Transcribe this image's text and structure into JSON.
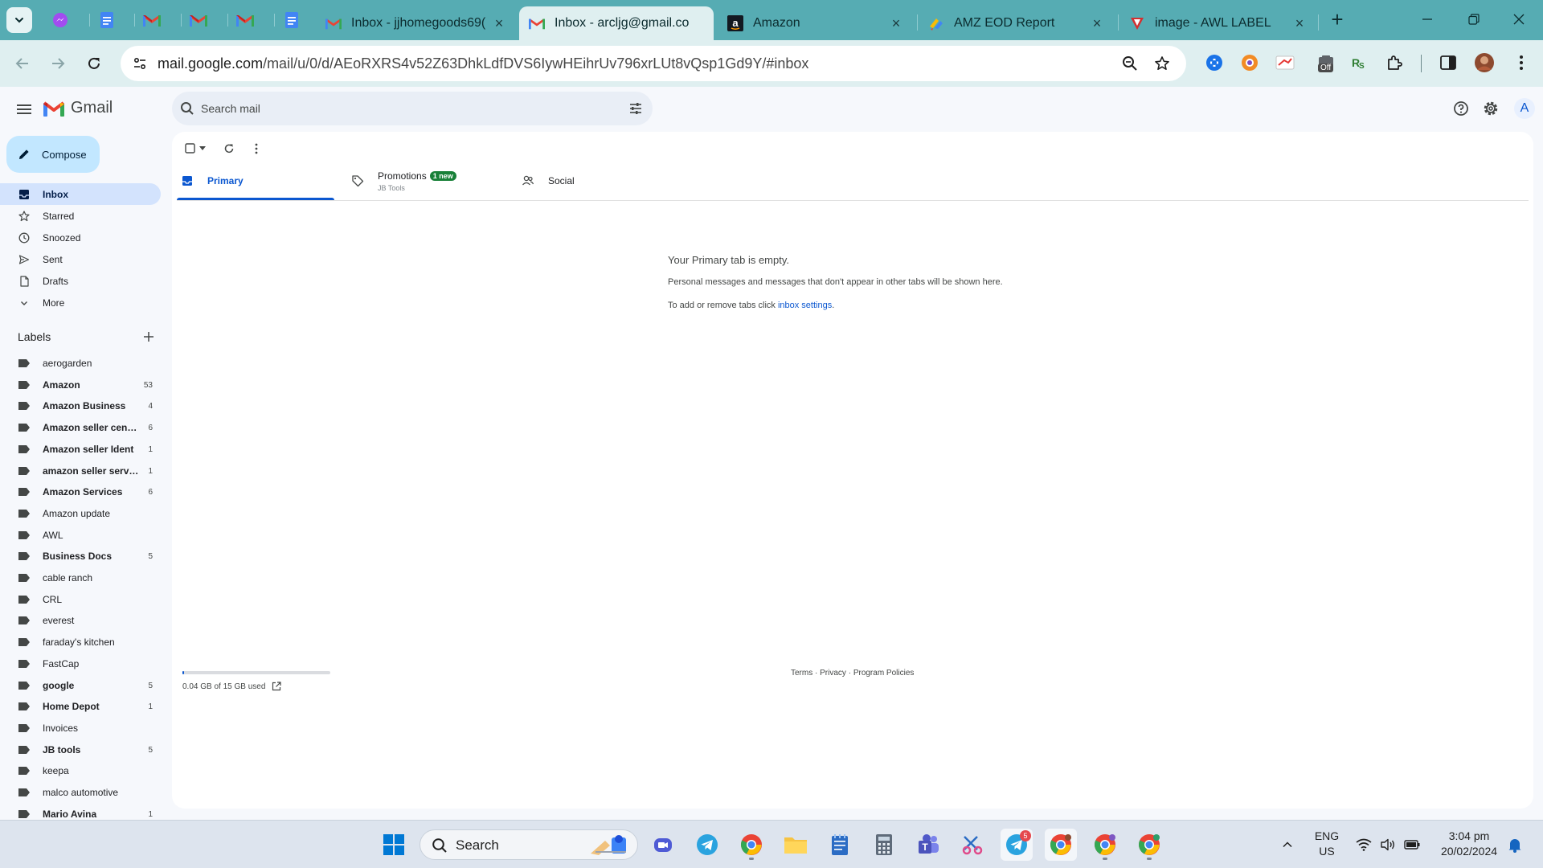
{
  "browser": {
    "pinned_tabs": [
      "messenger",
      "docs",
      "gmail",
      "gmail",
      "gmail",
      "docs"
    ],
    "tabs": [
      {
        "title": "Inbox - jjhomegoods69(",
        "favicon": "gmail-icon",
        "active": false
      },
      {
        "title": "Inbox - arcljg@gmail.co",
        "favicon": "gmail-icon",
        "active": true
      },
      {
        "title": "Amazon",
        "favicon": "amazon-icon",
        "active": false
      },
      {
        "title": "AMZ EOD Report",
        "favicon": "apps-script-icon",
        "active": false
      },
      {
        "title": "image - AWL LABEL",
        "favicon": "awl-icon",
        "active": false
      }
    ],
    "url_host": "mail.google.com",
    "url_path": "/mail/u/0/d/AEoRXRS4v52Z63DhkLdfDVS6IywHEihrUv796xrLUt8vQsp1Gd9Y/#inbox",
    "extension_badge": "Off"
  },
  "gmail": {
    "app_name": "Gmail",
    "search_placeholder": "Search mail",
    "account_initial": "A",
    "compose_label": "Compose",
    "nav": [
      {
        "label": "Inbox",
        "icon": "inbox-icon",
        "active": true
      },
      {
        "label": "Starred",
        "icon": "star-icon",
        "active": false
      },
      {
        "label": "Snoozed",
        "icon": "clock-icon",
        "active": false
      },
      {
        "label": "Sent",
        "icon": "send-icon",
        "active": false
      },
      {
        "label": "Drafts",
        "icon": "draft-icon",
        "active": false
      },
      {
        "label": "More",
        "icon": "chevron-down-icon",
        "active": false
      }
    ],
    "labels_title": "Labels",
    "labels": [
      {
        "name": "aerogarden",
        "count": "",
        "bold": false
      },
      {
        "name": "Amazon",
        "count": "53",
        "bold": true
      },
      {
        "name": "Amazon Business",
        "count": "4",
        "bold": true
      },
      {
        "name": "Amazon seller central",
        "count": "6",
        "bold": true
      },
      {
        "name": "Amazon seller Ident",
        "count": "1",
        "bold": true
      },
      {
        "name": "amazon seller services",
        "count": "1",
        "bold": true
      },
      {
        "name": "Amazon Services",
        "count": "6",
        "bold": true
      },
      {
        "name": "Amazon update",
        "count": "",
        "bold": false
      },
      {
        "name": "AWL",
        "count": "",
        "bold": false
      },
      {
        "name": "Business Docs",
        "count": "5",
        "bold": true
      },
      {
        "name": "cable ranch",
        "count": "",
        "bold": false
      },
      {
        "name": "CRL",
        "count": "",
        "bold": false
      },
      {
        "name": "everest",
        "count": "",
        "bold": false
      },
      {
        "name": "faraday's kitchen",
        "count": "",
        "bold": false
      },
      {
        "name": "FastCap",
        "count": "",
        "bold": false
      },
      {
        "name": "google",
        "count": "5",
        "bold": true
      },
      {
        "name": "Home Depot",
        "count": "1",
        "bold": true
      },
      {
        "name": "Invoices",
        "count": "",
        "bold": false
      },
      {
        "name": "JB tools",
        "count": "5",
        "bold": true
      },
      {
        "name": "keepa",
        "count": "",
        "bold": false
      },
      {
        "name": "malco automotive",
        "count": "",
        "bold": false
      },
      {
        "name": "Mario Avina",
        "count": "1",
        "bold": true
      }
    ],
    "category_tabs": {
      "primary": "Primary",
      "promotions": "Promotions",
      "promotions_badge": "1 new",
      "promotions_sub": "JB Tools",
      "social": "Social"
    },
    "empty": {
      "title": "Your Primary tab is empty.",
      "text": "Personal messages and messages that don't appear in other tabs will be shown here.",
      "settings_prefix": "To add or remove tabs click ",
      "settings_link": "inbox settings",
      "settings_suffix": "."
    },
    "storage": {
      "text": "0.04 GB of 15 GB used",
      "used_fraction": 0.003
    },
    "footer": {
      "terms": "Terms",
      "privacy": "Privacy",
      "policies": "Program Policies",
      "separator": " · "
    }
  },
  "taskbar": {
    "search_label": "Search",
    "telegram_badge": "5",
    "language": "ENG",
    "region": "US",
    "time": "3:04 pm",
    "date": "20/02/2024"
  },
  "colors": {
    "tab_strip": "#56acb3",
    "toolbar": "#dfeff0",
    "gmail_bg": "#f6f8fc",
    "compose": "#c2e7ff",
    "accent": "#0b57d0",
    "active_nav": "#d3e3fd",
    "badge_green": "#188038"
  }
}
